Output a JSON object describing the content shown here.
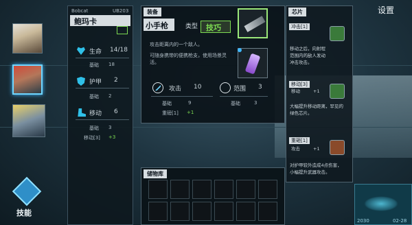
{
  "character": {
    "code": "Bobcat",
    "id": "UB203",
    "name": "鲍玛卡",
    "stats": {
      "hp_label": "生命",
      "hp_value": "14/18",
      "hp_base_label": "基础",
      "hp_base_value": "18",
      "armor_label": "护甲",
      "armor_value": "2",
      "armor_base_label": "基础",
      "armor_base_value": "2",
      "move_label": "移动",
      "move_value": "6",
      "move_base_label": "基础",
      "move_base_value": "3",
      "move_bonus_label": "移动[3]",
      "move_bonus_value": "+3"
    }
  },
  "equipment": {
    "header": "装备",
    "weapon_name": "小手枪",
    "type_label": "类型",
    "type_value": "技巧",
    "desc1": "攻击距离内的一个敌人。",
    "desc2": "可随身携带的便携枪支，使用场景灵活。",
    "attack_label": "攻击",
    "attack_value": "10",
    "range_label": "范围",
    "range_value": "3",
    "attack_base_label": "基础",
    "attack_base_value": "9",
    "range_base_label": "基础",
    "range_base_value": "3",
    "weight_label": "重磅[1]",
    "weight_value": "+1"
  },
  "chips": {
    "header": "芯片",
    "items": [
      {
        "title": "冲击[1]",
        "desc": "移动之后，向射程范围内的敌人发动冲击攻击。",
        "color": "#3a7a3a"
      },
      {
        "title": "移动[3]",
        "sub_label": "移动",
        "sub_value": "+1",
        "desc": "大幅提升移动距离，罕见的绿色芯片。",
        "color": "#3a7a3a"
      },
      {
        "title": "重砸[1]",
        "sub_label": "攻击",
        "sub_value": "+1",
        "desc": "对护甲较外造成4点伤害，小幅提升武器攻击。",
        "color": "#8a4a2a"
      }
    ]
  },
  "inventory": {
    "header": "储物库"
  },
  "skill": {
    "label": "技能"
  },
  "settings": {
    "label": "设置"
  },
  "minimap": {
    "left": "2030",
    "right": "02-28"
  },
  "colors": {
    "accent": "#6fd6ff",
    "green": "#7ddc52",
    "chip_green": "#3a7a3a",
    "chip_orange": "#8a4a2a"
  }
}
